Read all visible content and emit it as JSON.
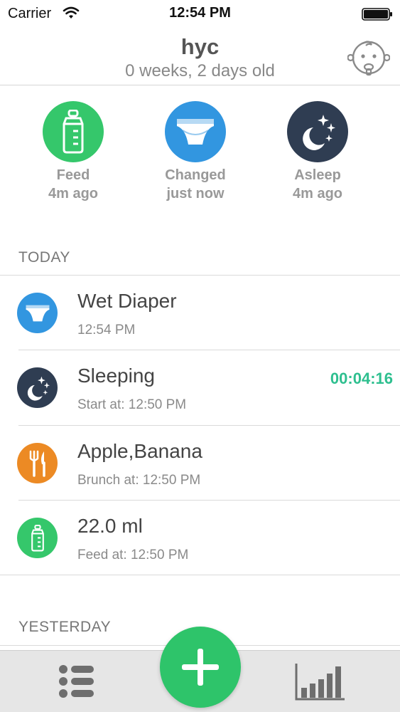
{
  "status_bar": {
    "carrier": "Carrier",
    "time": "12:54 PM"
  },
  "header": {
    "name": "hyc",
    "age": "0 weeks, 2 days old"
  },
  "quick_status": [
    {
      "action": "Feed",
      "when": "4m ago",
      "icon": "bottle-icon",
      "color": "#35c76b"
    },
    {
      "action": "Changed",
      "when": "just now",
      "icon": "diaper-icon",
      "color": "#3296e0"
    },
    {
      "action": "Asleep",
      "when": "4m ago",
      "icon": "moon-stars-icon",
      "color": "#2f3d52"
    }
  ],
  "sections": {
    "today": "TODAY",
    "yesterday": "YESTERDAY"
  },
  "today_entries": [
    {
      "title": "Wet Diaper",
      "subtitle": "12:54 PM",
      "icon": "diaper-icon",
      "color": "#3296e0",
      "timer": ""
    },
    {
      "title": "Sleeping",
      "subtitle": "Start at: 12:50 PM",
      "icon": "moon-stars-icon",
      "color": "#2f3d52",
      "timer": "00:04:16"
    },
    {
      "title": "Apple,Banana",
      "subtitle": "Brunch at: 12:50 PM",
      "icon": "fork-knife-icon",
      "color": "#ec8a24",
      "timer": ""
    },
    {
      "title": "22.0 ml",
      "subtitle": "Feed at: 12:50 PM",
      "icon": "bottle-icon",
      "color": "#35c76b",
      "timer": ""
    }
  ],
  "tab_bar": {
    "left_icon": "list-icon",
    "center_icon": "plus-icon",
    "right_icon": "bar-chart-icon"
  },
  "colors": {
    "accent_green": "#2ec46a",
    "timer_teal": "#2ebf8f"
  }
}
